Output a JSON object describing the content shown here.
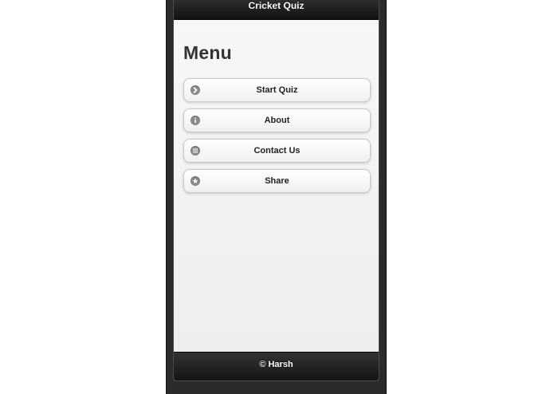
{
  "header": {
    "title": "Cricket Quiz"
  },
  "main": {
    "page_title": "Menu",
    "menu_items": [
      {
        "label": "Start Quiz",
        "icon": "arrow-right-icon"
      },
      {
        "label": "About",
        "icon": "info-icon"
      },
      {
        "label": "Contact Us",
        "icon": "grid-icon"
      },
      {
        "label": "Share",
        "icon": "star-icon"
      }
    ]
  },
  "footer": {
    "text": "© Harsh"
  },
  "colors": {
    "bar": "#1a1a1a",
    "content_bg": "#f3f3f3",
    "icon": "#8a8a8a"
  }
}
